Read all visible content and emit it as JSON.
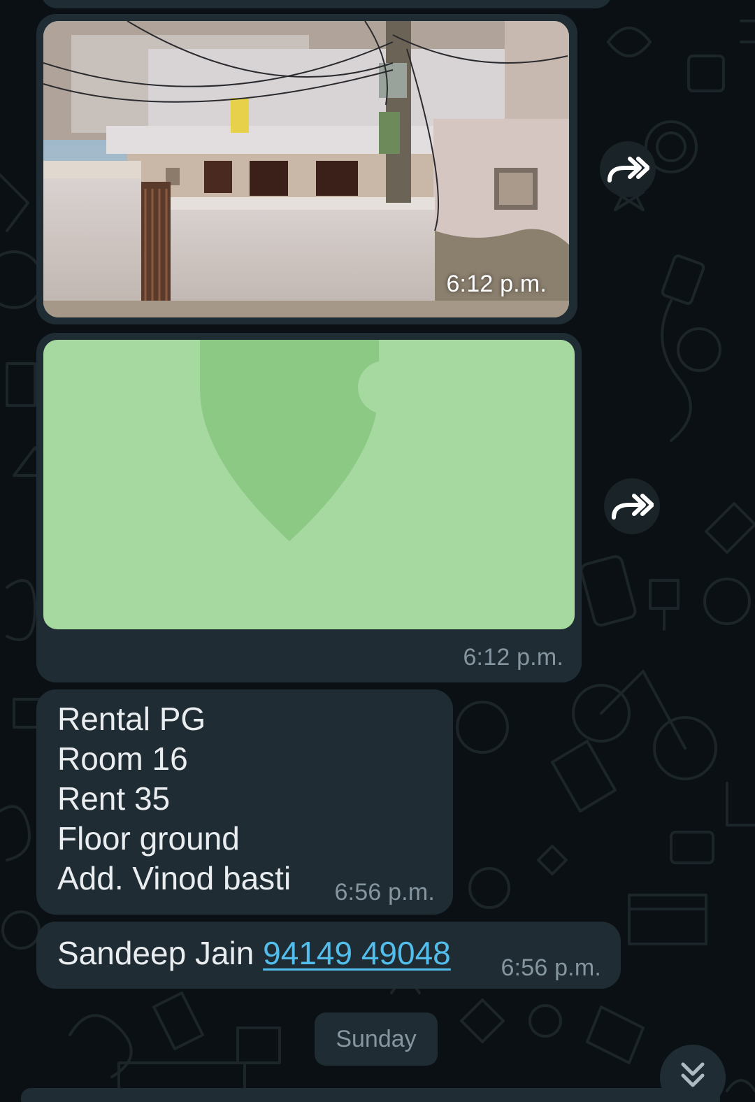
{
  "messages": {
    "photo": {
      "time": "6:12 p.m.",
      "icon": "forward-icon"
    },
    "location": {
      "time": "6:12 p.m.",
      "icon": "location-pin-icon"
    },
    "text": {
      "lines": [
        "Rental PG",
        "Room 16",
        "Rent 35",
        "Floor ground",
        "Add. Vinod basti"
      ],
      "time": "6:56 p.m."
    },
    "contact": {
      "name": "Sandeep Jain",
      "phone": "94149 49048",
      "time": "6:56 p.m."
    }
  },
  "date_separator": "Sunday",
  "scroll_button": {
    "icon": "double-chevron-down-icon"
  },
  "colors": {
    "background": "#0b1014",
    "bubble": "#1f2c33",
    "text": "#e9edef",
    "timestamp": "#8696a0",
    "link": "#53bdeb",
    "map_fill": "#a6d99f",
    "map_pin": "#8cc985"
  }
}
